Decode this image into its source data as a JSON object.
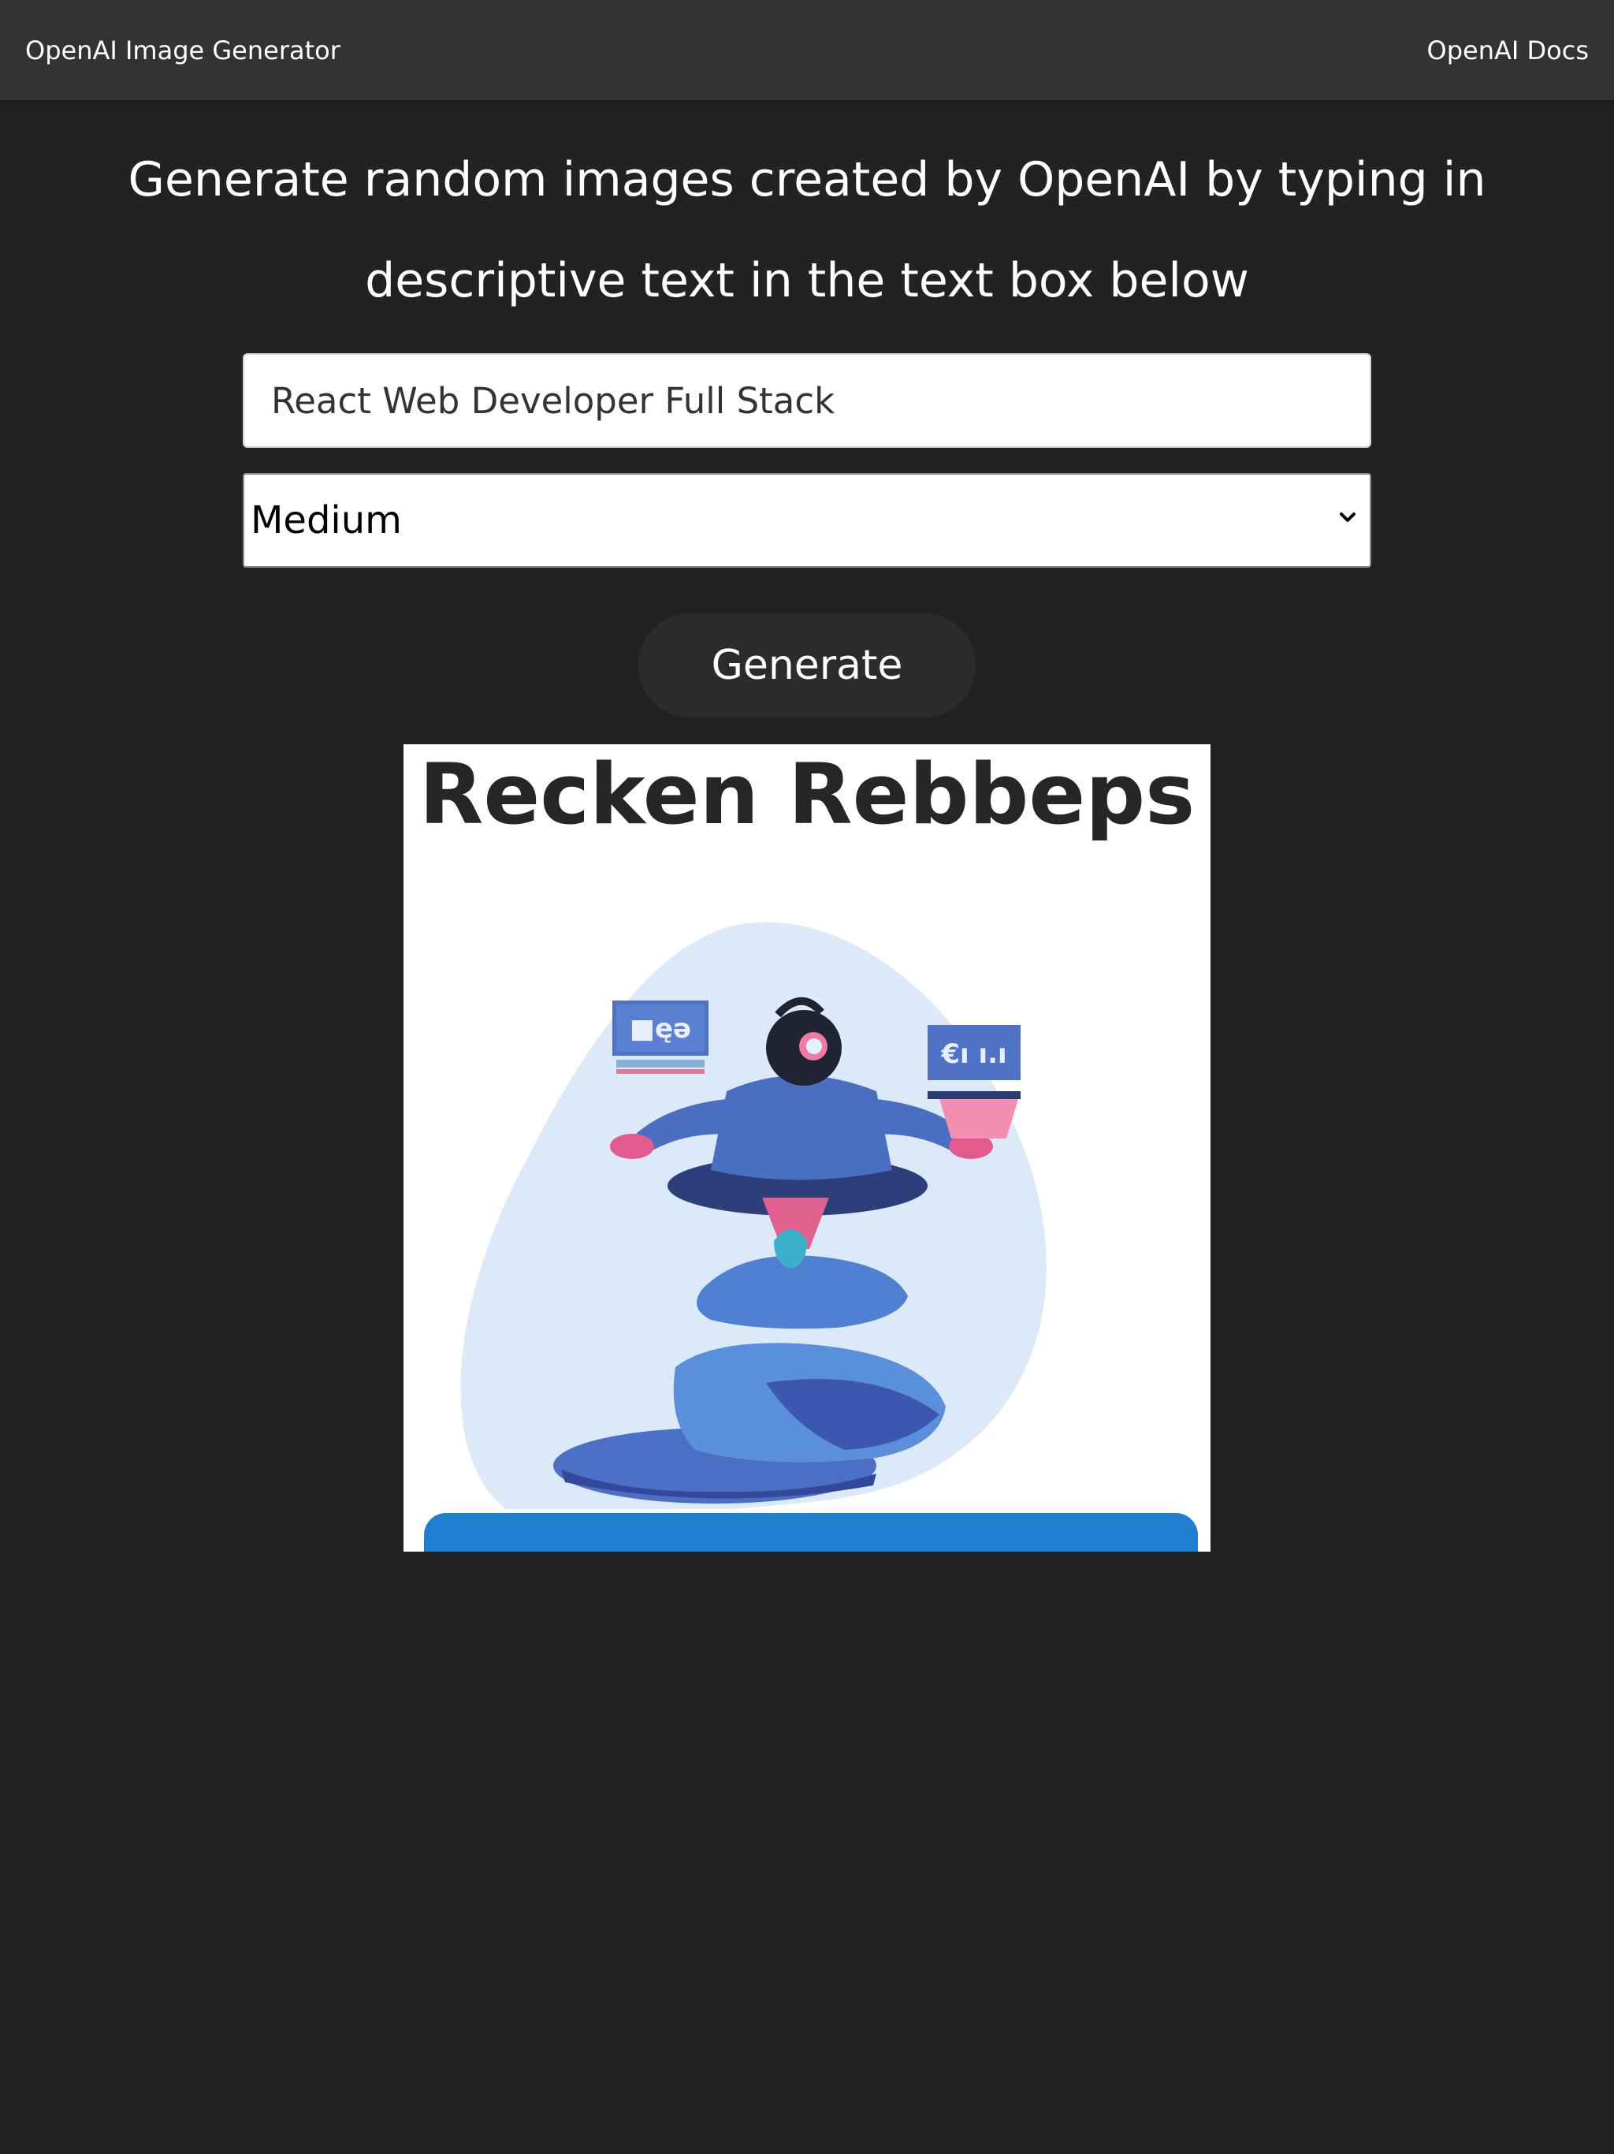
{
  "navbar": {
    "brand": "OpenAI Image Generator",
    "docs_link": "OpenAI Docs"
  },
  "heading": "Generate random images created by OpenAI by typing in descriptive text in the text box below",
  "prompt": {
    "value": "React Web Developer Full Stack"
  },
  "size_select": {
    "selected": "Medium"
  },
  "generate_button": "Generate",
  "image": {
    "caption_text": "Recken Rebbeps",
    "screen_left_text": "■ęə",
    "screen_right_text": "€ı ı.ı"
  },
  "colors": {
    "page_bg": "#222222",
    "navbar_bg": "#333333",
    "button_bg": "#2c2c2c",
    "text": "#ffffff"
  }
}
